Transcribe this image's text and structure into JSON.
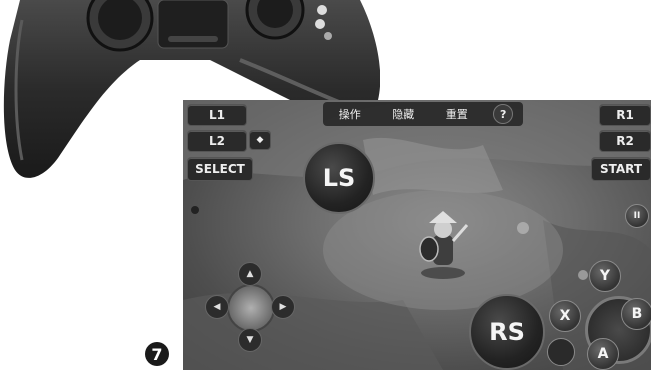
{
  "step_number": "7",
  "overlay": {
    "top_menu": [
      "操作",
      "隐藏",
      "重置"
    ],
    "help": "?",
    "left_buttons": {
      "l1": "L1",
      "l2": "L2",
      "select": "SELECT"
    },
    "right_buttons": {
      "r1": "R1",
      "r2": "R2",
      "start": "START"
    },
    "left_stick": "LS",
    "right_stick": "RS",
    "face_buttons": {
      "y": "Y",
      "x": "X",
      "b": "B",
      "a": "A"
    },
    "dpad_icons": [
      "up-arrow-icon",
      "down-arrow-icon",
      "left-arrow-icon",
      "right-arrow-icon"
    ]
  },
  "colors": {
    "controller_body": "#2b2b2b",
    "overlay_button": "#2a2a2a",
    "overlay_text": "#f2f2f2"
  }
}
